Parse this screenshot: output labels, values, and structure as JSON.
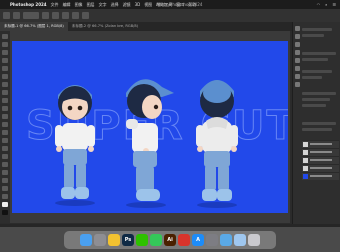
{
  "menubar": {
    "app_name": "Photoshop 2024",
    "items": [
      "文件",
      "编辑",
      "图像",
      "图层",
      "文字",
      "选择",
      "滤镜",
      "3D",
      "视图",
      "增效工具",
      "窗口",
      "帮助"
    ],
    "window_title": "Adobe Photoshop 2024"
  },
  "tabs": [
    {
      "label": "未标题-1 @ 66.7% (图层 1, RGB/8)"
    },
    {
      "label": "未标题-2 @ 66.7% (Zolan bre, RGB/8)"
    }
  ],
  "artwork": {
    "background_color": "#2249ea",
    "headline": "SUPER CUTE"
  },
  "dock": {
    "apps": [
      {
        "name": "finder",
        "label": "",
        "color": "#4aa0f0"
      },
      {
        "name": "launchpad",
        "label": "",
        "color": "#8e8e93"
      },
      {
        "name": "chrome",
        "label": "",
        "color": "#f2c230"
      },
      {
        "name": "photoshop",
        "label": "Ps",
        "color": "#0f2a45"
      },
      {
        "name": "wechat",
        "label": "",
        "color": "#2dc100"
      },
      {
        "name": "messages",
        "label": "",
        "color": "#34c759"
      },
      {
        "name": "illustrator",
        "label": "Ai",
        "color": "#4a2000"
      },
      {
        "name": "pdf-reader",
        "label": "",
        "color": "#d9342b"
      },
      {
        "name": "app-store",
        "label": "A",
        "color": "#1d8cf8"
      },
      {
        "name": "system-settings",
        "label": "",
        "color": "#7d7d83"
      },
      {
        "name": "preview",
        "label": "",
        "color": "#5aa9e6"
      },
      {
        "name": "finder-window",
        "label": "",
        "color": "#9fc7ef"
      },
      {
        "name": "trash",
        "label": "",
        "color": "#c9c9ce"
      }
    ]
  }
}
